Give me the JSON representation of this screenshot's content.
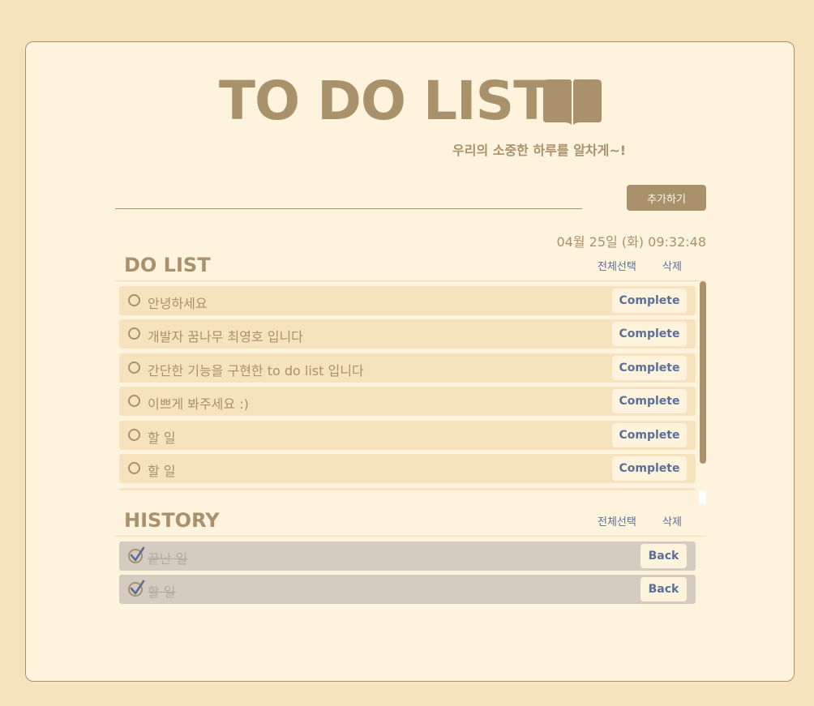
{
  "header": {
    "title": "TO DO LIST",
    "subtitle": "우리의 소중한 하루를 알차게~!",
    "title_icon": "book-icon"
  },
  "input": {
    "value": "",
    "placeholder": ""
  },
  "add_button_label": "추가하기",
  "datetime": "04월 25일 (화) 09:32:48",
  "todo": {
    "title": "DO LIST",
    "select_all_label": "전체선택",
    "delete_label": "삭제",
    "items": [
      {
        "text": "안녕하세요",
        "action": "Complete"
      },
      {
        "text": "개발자 꿈나무 최영호 입니다",
        "action": "Complete"
      },
      {
        "text": "간단한 기능을 구현한 to do list 입니다",
        "action": "Complete"
      },
      {
        "text": "이쁘게 봐주세요 :)",
        "action": "Complete"
      },
      {
        "text": "할 일",
        "action": "Complete"
      },
      {
        "text": "할 일",
        "action": "Complete"
      },
      {
        "text": "",
        "action": ""
      }
    ]
  },
  "history": {
    "title": "HISTORY",
    "select_all_label": "전체선택",
    "delete_label": "삭제",
    "items": [
      {
        "text": "끝난 일",
        "action": "Back"
      },
      {
        "text": "할 일",
        "action": "Back"
      }
    ]
  },
  "colors": {
    "background": "#f6e2bc",
    "card": "#fef3dc",
    "accent": "#a9916c",
    "button_text": "#5b6f97",
    "history_item": "#d4ccc1"
  }
}
